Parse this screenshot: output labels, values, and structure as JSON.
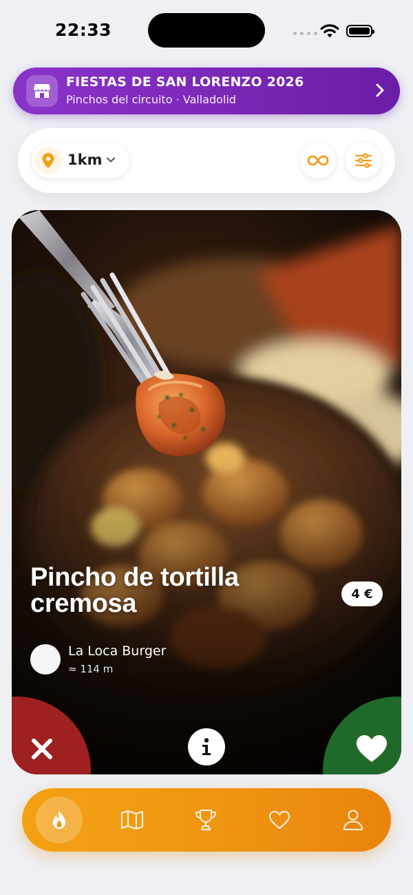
{
  "status_bar": {
    "time": "22:33",
    "icons": [
      "cellular-signal-icon",
      "wifi-icon",
      "battery-icon"
    ]
  },
  "event_banner": {
    "title": "FIESTAS DE SAN LORENZO 2026",
    "subtitle": "Pinchos del circuito · Valladolid",
    "icon": "storefront-icon",
    "action_icon": "chevron-right-icon",
    "gradient": [
      "#8a33c9",
      "#6a1da6"
    ]
  },
  "filters": {
    "distance": "1km",
    "distance_icon": "map-pin-icon",
    "distance_dropdown_icon": "chevron-down-icon",
    "actions": [
      "infinity-icon",
      "sliders-icon"
    ]
  },
  "card": {
    "dish_name": "Pincho de tortilla cremosa",
    "price": "4 €",
    "venue": {
      "name": "La Loca Burger",
      "distance": "≈ 114 m"
    },
    "actions": {
      "reject_icon": "close-icon",
      "info_icon": "info-icon",
      "like_icon": "heart-icon"
    }
  },
  "bottom_nav": {
    "items": [
      {
        "name": "discover",
        "icon": "flame-icon",
        "active": true
      },
      {
        "name": "map",
        "icon": "map-icon",
        "active": false
      },
      {
        "name": "ranking",
        "icon": "trophy-icon",
        "active": false
      },
      {
        "name": "favorites",
        "icon": "heart-outline-icon",
        "active": false
      },
      {
        "name": "profile",
        "icon": "user-icon",
        "active": false
      }
    ]
  },
  "colors": {
    "accent": "#f09612",
    "reject": "#9e2020",
    "like": "#1f6a2a",
    "background": "#eef0f4"
  }
}
